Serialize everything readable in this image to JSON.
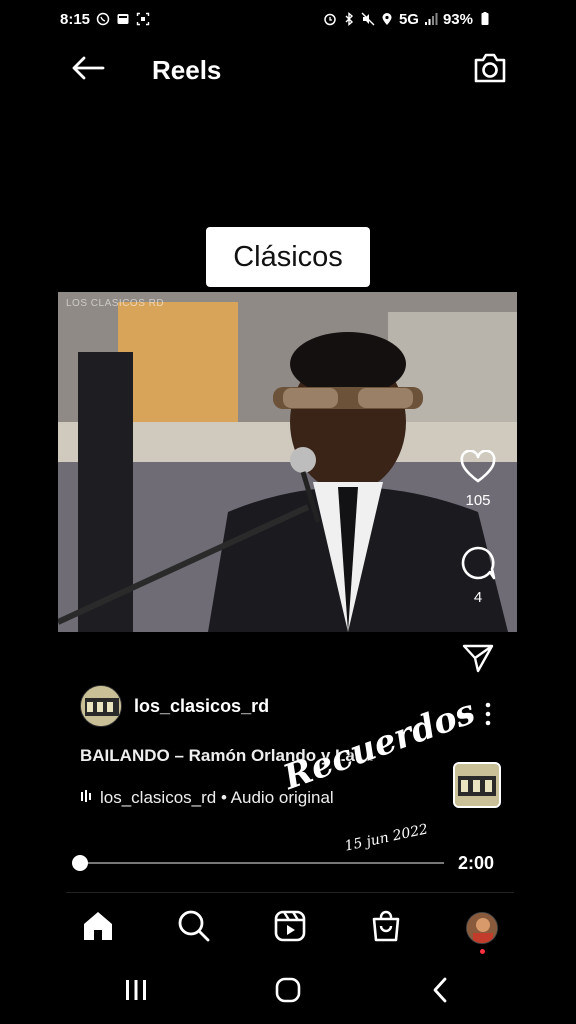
{
  "status_bar": {
    "time": "8:15",
    "network": "5G",
    "battery": "93%",
    "left_icons": [
      "whatsapp-icon",
      "news-icon",
      "screenshot-icon"
    ],
    "right_icons": [
      "alarm-icon",
      "bluetooth-icon",
      "mute-icon",
      "location-icon",
      "signal-icon",
      "battery-icon"
    ]
  },
  "header": {
    "title": "Reels",
    "back_icon": "back-arrow-icon",
    "camera_icon": "camera-icon"
  },
  "video": {
    "caption_sticker": "Clásicos",
    "watermark": "LOS CLASICOS RD"
  },
  "actions": {
    "like_count": "105",
    "comment_count": "4"
  },
  "post": {
    "username": "los_clasicos_rd",
    "song_title": "BAILANDO – Ramón Orlando y La ...",
    "audio_label": "los_clasicos_rd • Audio original"
  },
  "overlay": {
    "handwritten_word": "Recuerdos",
    "date": "15 jun 2022"
  },
  "player": {
    "duration": "2:00",
    "progress": 0.0
  },
  "bottom_nav": [
    "home-icon",
    "search-icon",
    "reels-icon",
    "shop-icon",
    "profile-avatar"
  ],
  "system_nav": [
    "recents-icon",
    "home-circle-icon",
    "back-chevron-icon"
  ],
  "colors": {
    "background": "#000000",
    "text": "#ffffff",
    "notification_dot": "#ff3040"
  }
}
